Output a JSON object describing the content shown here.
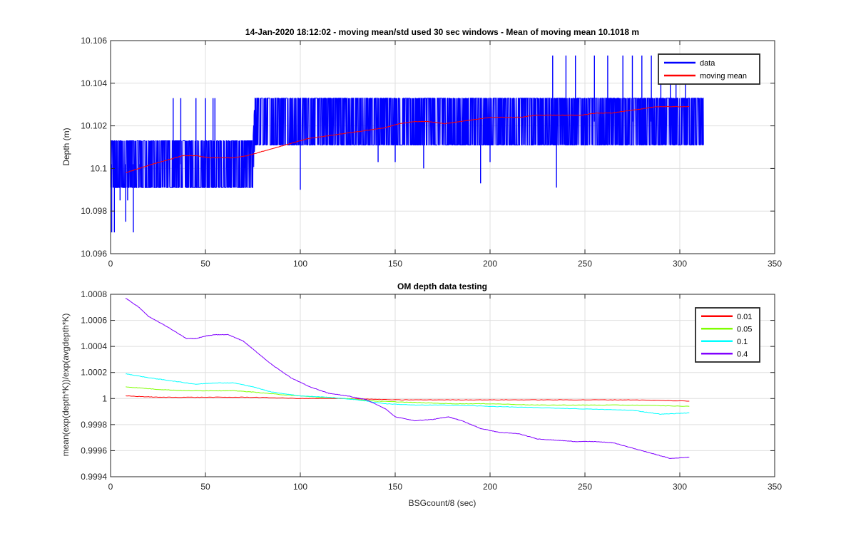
{
  "chart_data": [
    {
      "type": "line",
      "title": "14-Jan-2020 18:12:02 - moving mean/std used 30 sec windows - Mean of moving mean 10.1018 m",
      "xlabel": "",
      "ylabel": "Depth (m)",
      "xlim": [
        0,
        350
      ],
      "ylim": [
        10.096,
        10.106
      ],
      "xticks": [
        "0",
        "50",
        "100",
        "150",
        "200",
        "250",
        "300",
        "350"
      ],
      "yticks": [
        "10.096",
        "10.098",
        "10.1",
        "10.102",
        "10.104",
        "10.106"
      ],
      "grid": true,
      "legend_position": "top-right",
      "series": [
        {
          "name": "data",
          "color": "#0000ff",
          "noisy": true,
          "x_range": [
            0,
            312.5
          ],
          "lower_envelope": [
            [
              0,
              10.0991
            ],
            [
              75,
              10.0991
            ],
            [
              76,
              10.1011
            ],
            [
              312.5,
              10.1011
            ]
          ],
          "upper_envelope": [
            [
              0,
              10.1013
            ],
            [
              75,
              10.1013
            ],
            [
              76,
              10.1033
            ],
            [
              312.5,
              10.1033
            ]
          ],
          "spikes": [
            [
              0.6,
              10.097
            ],
            [
              2,
              10.097
            ],
            [
              5,
              10.0985
            ],
            [
              8,
              10.0975
            ],
            [
              9,
              10.0985
            ],
            [
              12,
              10.097
            ],
            [
              15,
              10.0991
            ],
            [
              33,
              10.1033
            ],
            [
              37,
              10.1033
            ],
            [
              45,
              10.1033
            ],
            [
              50,
              10.1033
            ],
            [
              54,
              10.1033
            ],
            [
              55,
              10.1033
            ],
            [
              100,
              10.099
            ],
            [
              130,
              10.1033
            ],
            [
              141,
              10.1003
            ],
            [
              150,
              10.1003
            ],
            [
              165,
              10.1
            ],
            [
              195,
              10.0993
            ],
            [
              200,
              10.1003
            ],
            [
              235,
              10.0991
            ],
            [
              233,
              10.1053
            ],
            [
              240,
              10.1053
            ],
            [
              245,
              10.1053
            ],
            [
              255,
              10.1053
            ],
            [
              262,
              10.1053
            ],
            [
              270,
              10.1053
            ],
            [
              275,
              10.1053
            ],
            [
              280,
              10.1053
            ],
            [
              285,
              10.1053
            ],
            [
              290,
              10.1053
            ],
            [
              295,
              10.1053
            ],
            [
              298,
              10.1053
            ],
            [
              303,
              10.1053
            ]
          ]
        },
        {
          "name": "moving mean",
          "color": "#ff0000",
          "x": [
            8,
            15,
            22,
            30,
            38,
            45,
            52,
            58,
            65,
            72,
            80,
            88,
            96,
            104,
            112,
            120,
            128,
            136,
            144,
            152,
            160,
            168,
            176,
            184,
            192,
            200,
            208,
            216,
            224,
            232,
            240,
            248,
            256,
            264,
            272,
            280,
            288,
            296,
            305
          ],
          "y": [
            10.0998,
            10.1,
            10.1002,
            10.1004,
            10.1006,
            10.1006,
            10.1005,
            10.1005,
            10.1005,
            10.1006,
            10.1008,
            10.101,
            10.1012,
            10.1014,
            10.1015,
            10.1016,
            10.1017,
            10.1018,
            10.1019,
            10.1021,
            10.1022,
            10.1022,
            10.1021,
            10.1022,
            10.1023,
            10.1024,
            10.1024,
            10.1024,
            10.1025,
            10.1025,
            10.1025,
            10.1025,
            10.1026,
            10.1026,
            10.1027,
            10.1028,
            10.1029,
            10.1029,
            10.1029
          ]
        }
      ]
    },
    {
      "type": "line",
      "title": "OM depth data testing",
      "xlabel": "BSGcount/8 (sec)",
      "ylabel": "mean(exp(depth*K))/exp(avgdepth*K)",
      "xlim": [
        0,
        350
      ],
      "ylim": [
        0.9994,
        1.0008
      ],
      "xticks": [
        "0",
        "50",
        "100",
        "150",
        "200",
        "250",
        "300",
        "350"
      ],
      "yticks": [
        "0.9994",
        "0.9996",
        "0.9998",
        "1",
        "1.0002",
        "1.0004",
        "1.0006",
        "1.0008"
      ],
      "grid": true,
      "legend_position": "top-right",
      "series": [
        {
          "name": "0.01",
          "color": "#ff0000",
          "x": [
            8,
            25,
            50,
            75,
            100,
            125,
            150,
            175,
            200,
            225,
            250,
            275,
            305
          ],
          "y": [
            1.00002,
            1.00001,
            1.00001,
            1.00001,
            1.0,
            1.0,
            0.99999,
            0.99999,
            0.99999,
            0.99999,
            0.99999,
            0.99999,
            0.99998
          ]
        },
        {
          "name": "0.05",
          "color": "#7fff00",
          "x": [
            8,
            25,
            40,
            55,
            65,
            75,
            90,
            100,
            110,
            125,
            140,
            160,
            180,
            200,
            225,
            250,
            275,
            305
          ],
          "y": [
            1.00009,
            1.00007,
            1.00006,
            1.00006,
            1.00006,
            1.00005,
            1.00003,
            1.00002,
            1.00001,
            1.0,
            0.99998,
            0.99997,
            0.99996,
            0.99996,
            0.99995,
            0.99995,
            0.99995,
            0.99994
          ]
        },
        {
          "name": "0.1",
          "color": "#00ffff",
          "x": [
            8,
            20,
            30,
            45,
            55,
            65,
            75,
            85,
            100,
            115,
            130,
            145,
            160,
            180,
            200,
            225,
            250,
            275,
            290,
            305
          ],
          "y": [
            1.00019,
            1.00016,
            1.00014,
            1.00011,
            1.00012,
            1.00012,
            1.00009,
            1.00005,
            1.00002,
            1.00001,
            0.99999,
            0.99996,
            0.99995,
            0.99995,
            0.99994,
            0.99993,
            0.99992,
            0.99991,
            0.99988,
            0.99989
          ]
        },
        {
          "name": "0.4",
          "color": "#8000ff",
          "x": [
            8,
            15,
            20,
            30,
            40,
            45,
            50,
            55,
            62,
            70,
            75,
            85,
            95,
            105,
            115,
            125,
            135,
            145,
            150,
            160,
            170,
            178,
            185,
            195,
            205,
            215,
            225,
            235,
            245,
            255,
            265,
            275,
            285,
            295,
            305
          ],
          "y": [
            1.00077,
            1.0007,
            1.00063,
            1.00055,
            1.00046,
            1.00046,
            1.00048,
            1.00049,
            1.00049,
            1.00044,
            1.00038,
            1.00026,
            1.00016,
            1.00009,
            1.00004,
            1.00002,
            0.99999,
            0.99992,
            0.99986,
            0.99983,
            0.99984,
            0.99986,
            0.99983,
            0.99977,
            0.99974,
            0.99973,
            0.99969,
            0.99968,
            0.99967,
            0.99967,
            0.99966,
            0.99962,
            0.99958,
            0.99954,
            0.99955
          ]
        }
      ]
    }
  ]
}
